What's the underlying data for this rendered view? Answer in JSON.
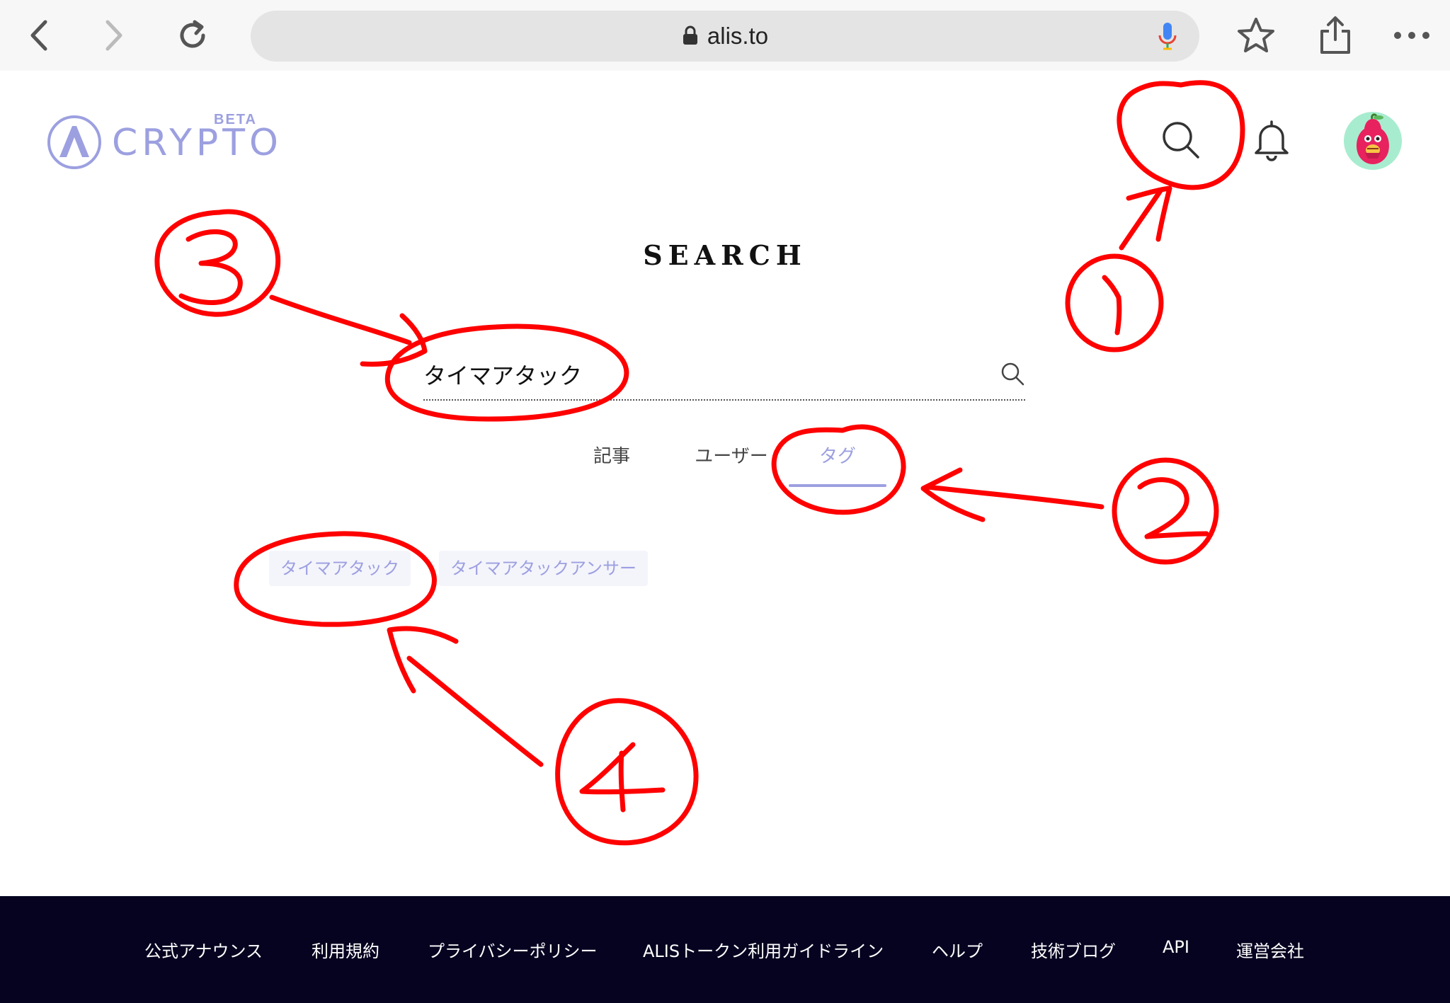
{
  "browser": {
    "url": "alis.to",
    "icons": {
      "back": "chevron-left-icon",
      "forward": "chevron-right-icon",
      "reload": "reload-icon",
      "lock": "lock-icon",
      "mic": "microphone-icon",
      "bookmark": "star-icon",
      "share": "share-icon",
      "more": "ellipsis-icon"
    }
  },
  "header": {
    "logo_beta": "BETA",
    "logo_text": "CRYPTO",
    "search_icon": "search-icon",
    "bell_icon": "bell-icon",
    "avatar": "avatar"
  },
  "search": {
    "title": "SEARCH",
    "query": "タイマアタック"
  },
  "tabs": [
    {
      "label": "記事",
      "active": false
    },
    {
      "label": "ユーザー",
      "active": false
    },
    {
      "label": "タグ",
      "active": true
    }
  ],
  "results": {
    "tags": [
      "タイマアタック",
      "タイマアタックアンサー"
    ]
  },
  "footer": {
    "links": [
      "公式アナウンス",
      "利用規約",
      "プライバシーポリシー",
      "ALISトークン利用ガイドライン",
      "ヘルプ",
      "技術ブログ",
      "API",
      "運営会社"
    ]
  },
  "annotations": {
    "labels": [
      "①",
      "②",
      "③",
      "④"
    ],
    "color": "#ff0000"
  },
  "colors": {
    "accent": "#9ca0e0",
    "footer_bg": "#060320",
    "annotation": "#ff0000"
  }
}
